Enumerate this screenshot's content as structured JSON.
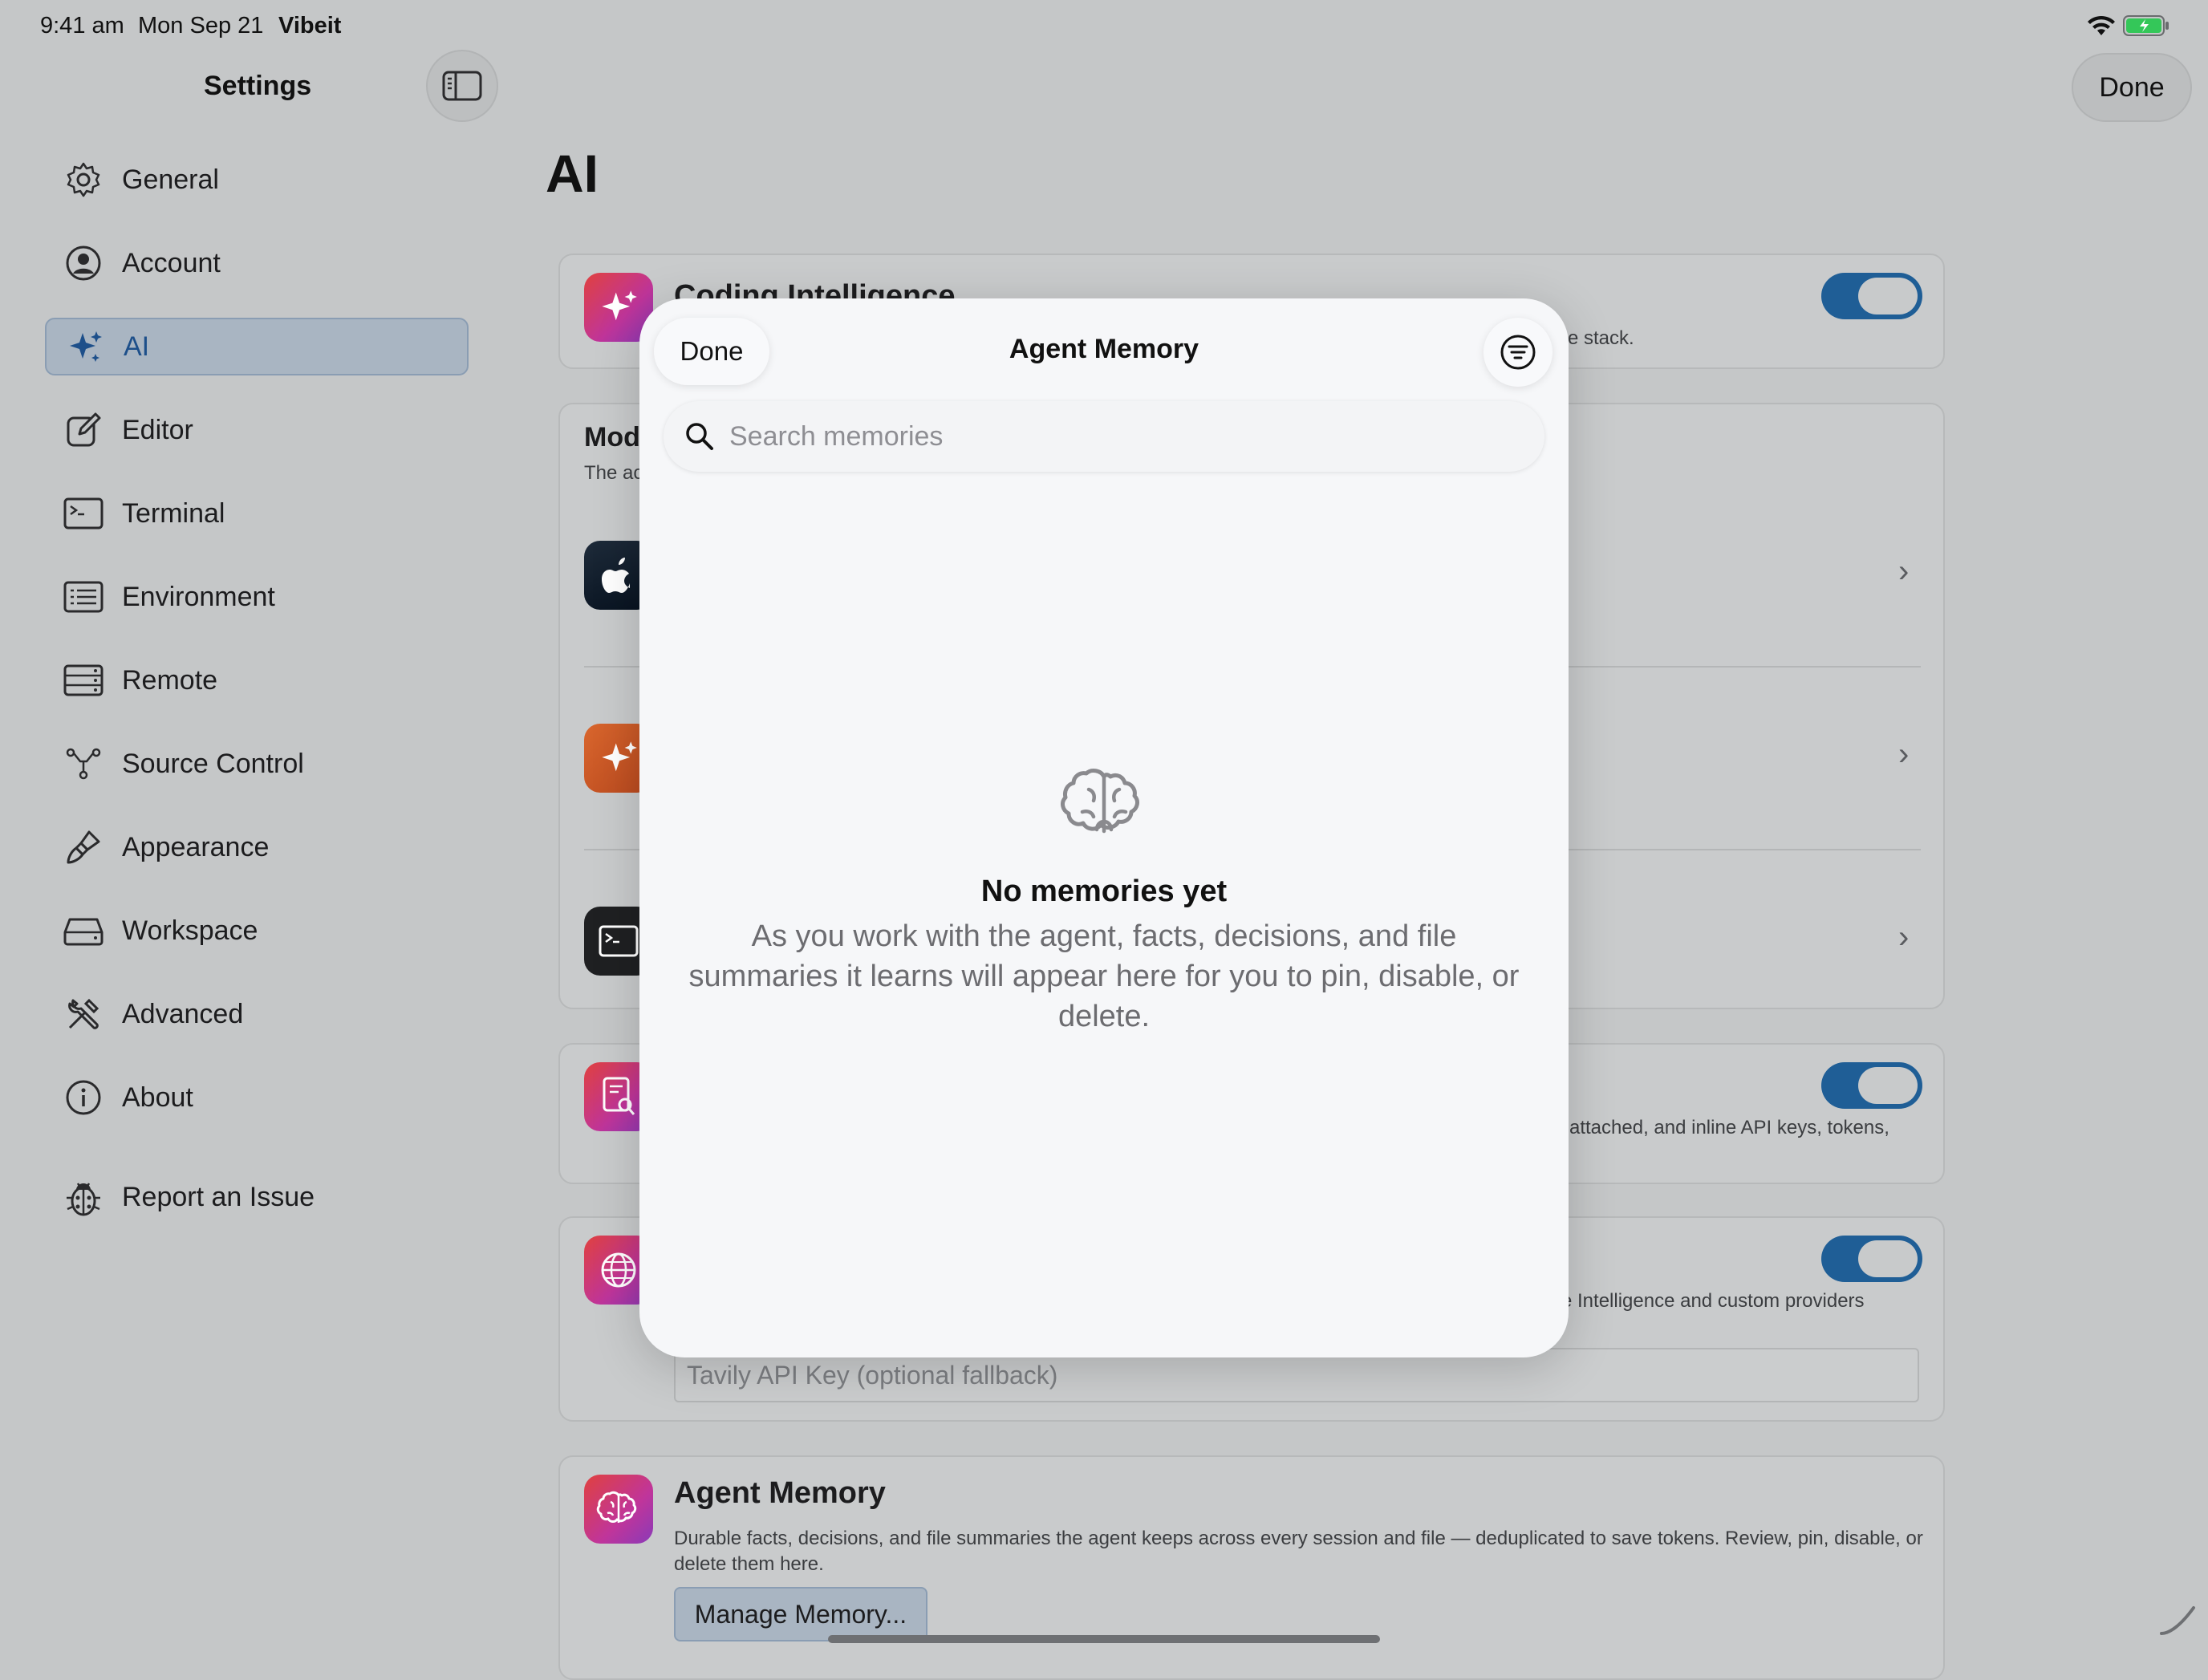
{
  "status_bar": {
    "time": "9:41 am",
    "date": "Mon Sep 21",
    "app": "Vibeit"
  },
  "sidebar": {
    "title": "Settings",
    "items": [
      {
        "label": "General",
        "icon": "gear-icon"
      },
      {
        "label": "Account",
        "icon": "person-circle-icon"
      },
      {
        "label": "AI",
        "icon": "sparkles-icon",
        "active": true
      },
      {
        "label": "Editor",
        "icon": "pencil-square-icon"
      },
      {
        "label": "Terminal",
        "icon": "terminal-icon"
      },
      {
        "label": "Environment",
        "icon": "list-rectangle-icon"
      },
      {
        "label": "Remote",
        "icon": "server-rack-icon"
      },
      {
        "label": "Source Control",
        "icon": "branch-icon"
      },
      {
        "label": "Appearance",
        "icon": "paintbrush-icon"
      },
      {
        "label": "Workspace",
        "icon": "drive-icon"
      },
      {
        "label": "Advanced",
        "icon": "tools-icon"
      },
      {
        "label": "About",
        "icon": "info-circle-icon"
      },
      {
        "label": "Report an Issue",
        "icon": "ladybug-icon"
      }
    ]
  },
  "header": {
    "done_label": "Done",
    "page_title": "AI"
  },
  "background": {
    "coding_intelligence": {
      "title": "Coding Intelligence",
      "desc_tail": "e stack."
    },
    "models": {
      "title_partial": "Mod",
      "desc_partial": "The ac"
    },
    "privacy_desc_tail": "attached, and inline API keys, tokens,",
    "web_desc_tail": "e Intelligence and custom providers",
    "tavily_placeholder": "Tavily API Key (optional fallback)",
    "agent_memory": {
      "title": "Agent Memory",
      "desc": "Durable facts, decisions, and file summaries the agent keeps across every session and file — deduplicated to save tokens. Review, pin, disable, or delete them here.",
      "button": "Manage Memory..."
    }
  },
  "modal": {
    "done_label": "Done",
    "title": "Agent Memory",
    "search_placeholder": "Search memories",
    "empty_title": "No memories yet",
    "empty_body": "As you work with the agent, facts, decisions, and file summaries it learns will appear here for you to pin, disable, or delete."
  },
  "colors": {
    "accent": "#1f5e96",
    "sidebar_active": "#a9b5c2",
    "modal_bg": "#f6f7f9"
  }
}
